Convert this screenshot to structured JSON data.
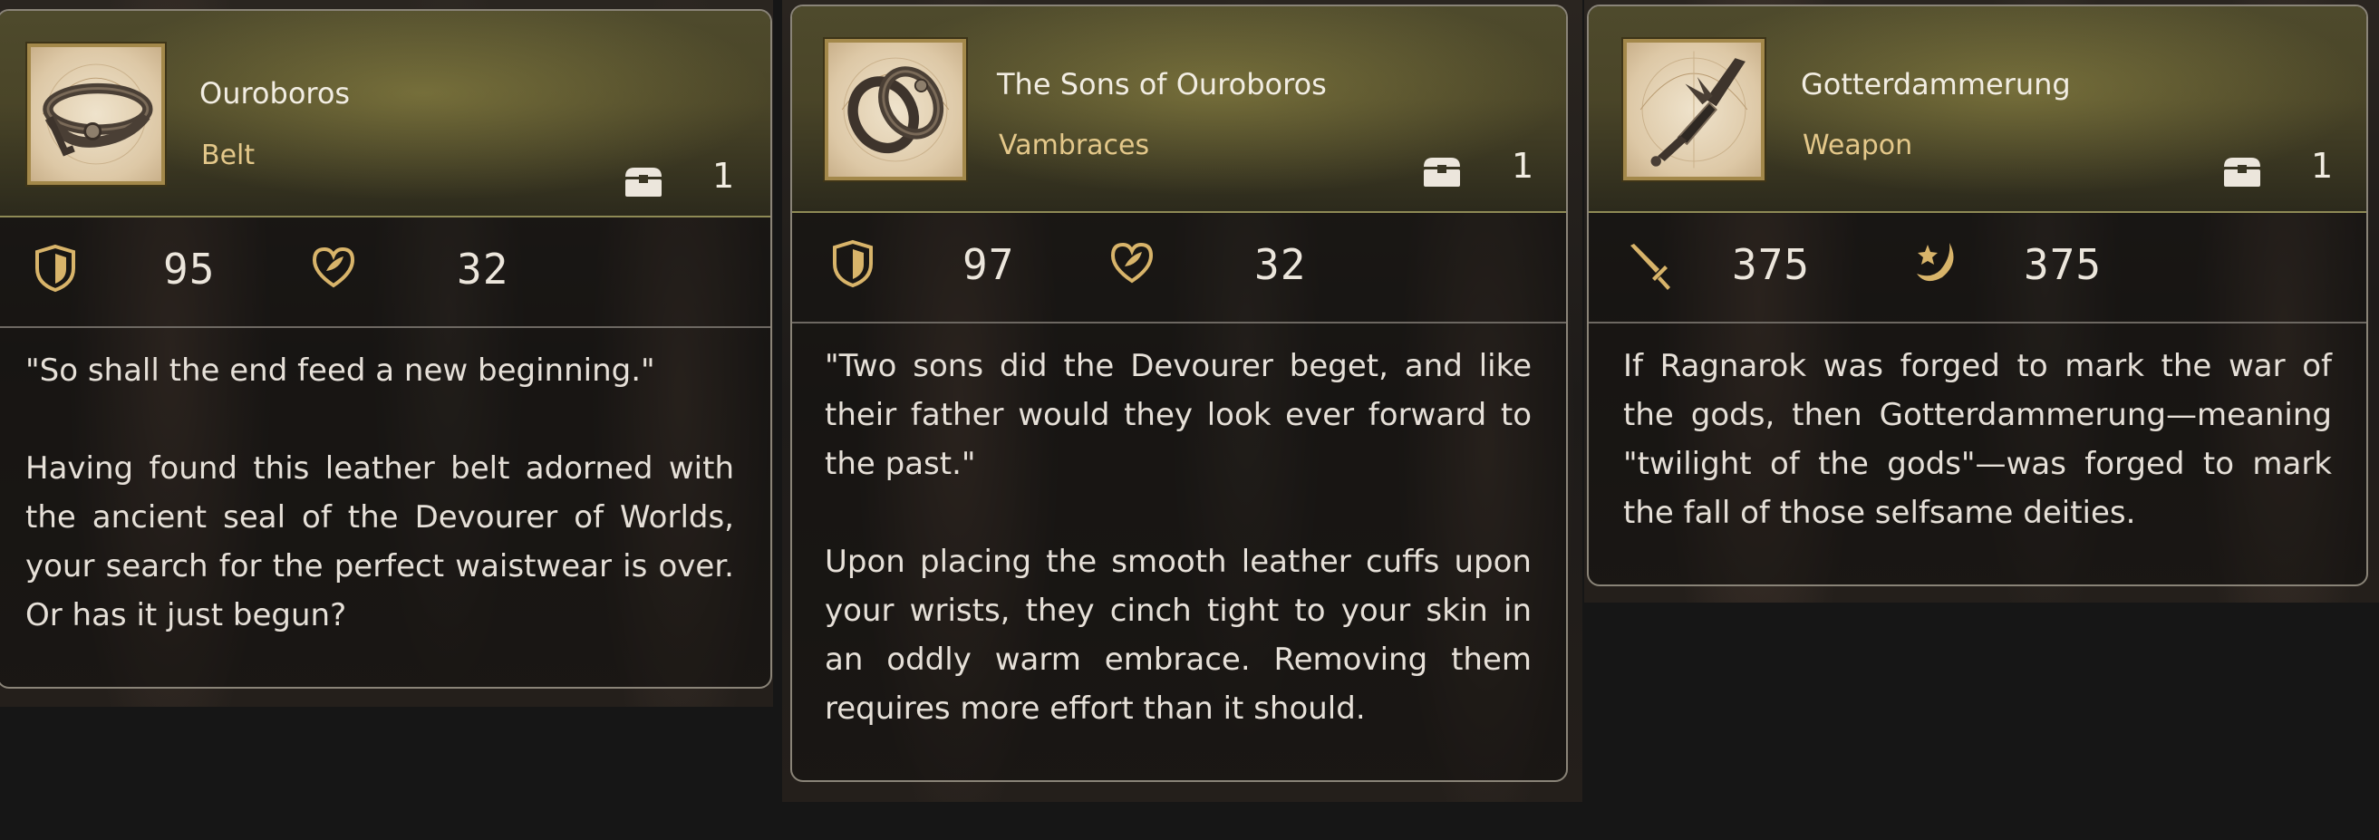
{
  "cards": [
    {
      "name": "Ouroboros",
      "type": "Belt",
      "count": "1",
      "thumbnail_icon": "belt-icon",
      "stats": [
        {
          "icon": "shield-icon",
          "value": "95"
        },
        {
          "icon": "heart-icon",
          "value": "32"
        }
      ],
      "quote": "\"So shall the end feed a new beginning.\"",
      "description": "Having found this leather belt adorned with the ancient seal of the Devourer of Worlds, your search for the perfect waistwear is over. Or has it just begun?"
    },
    {
      "name": "The Sons of Ouroboros",
      "type": "Vambraces",
      "count": "1",
      "thumbnail_icon": "vambraces-icon",
      "stats": [
        {
          "icon": "shield-icon",
          "value": "97"
        },
        {
          "icon": "heart-icon",
          "value": "32"
        }
      ],
      "quote": "\"Two sons did the Devourer beget, and like their father would they look ever forward to the past.\"",
      "description": "Upon placing the smooth leather cuffs upon your wrists, they cinch tight to your skin in an oddly warm embrace. Removing them requires more effort than it should."
    },
    {
      "name": "Gotterdammerung",
      "type": "Weapon",
      "count": "1",
      "thumbnail_icon": "greatsword-icon",
      "stats": [
        {
          "icon": "sword-icon",
          "value": "375"
        },
        {
          "icon": "magic-star-icon",
          "value": "375"
        }
      ],
      "description": "If Ragnarok was forged to mark the war of the gods, then Gotterdammerung—meaning \"twilight of the gods\"—was forged to mark the fall of those selfsame deities."
    }
  ],
  "colors": {
    "header_gold": "#4e4a2c",
    "type_text": "#e4c88a",
    "icon_gold": "#d8b46a",
    "frame_gold": "#a3884a"
  }
}
